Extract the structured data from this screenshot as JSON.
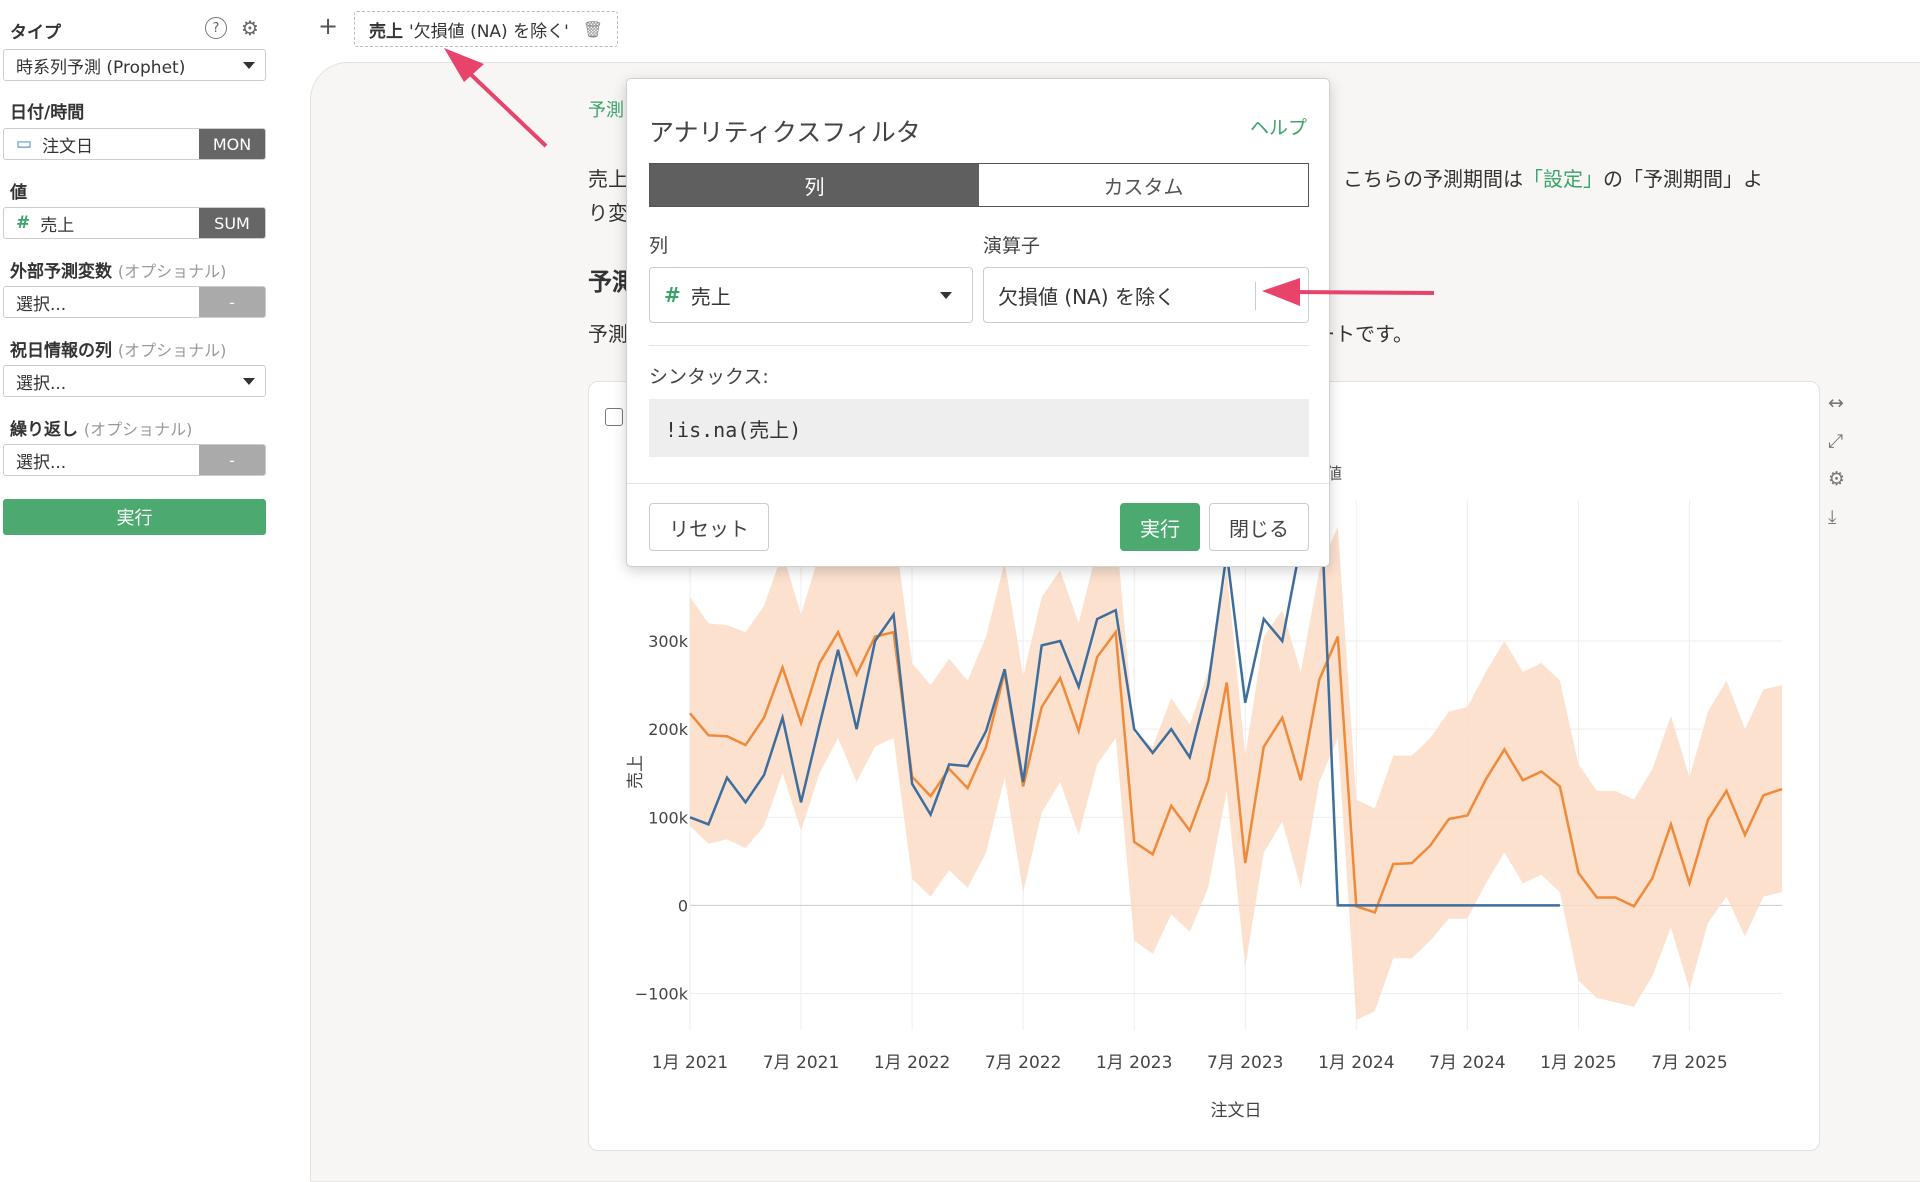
{
  "sidebar": {
    "type_label": "タイプ",
    "type_value": "時系列予測 (Prophet)",
    "date_label": "日付/時間",
    "date_field": "注文日",
    "date_unit": "MON",
    "value_label": "値",
    "value_field": "売上",
    "value_agg": "SUM",
    "ext_label": "外部予測変数",
    "ext_opt": "(オプショナル)",
    "ext_placeholder": "選択...",
    "ext_tag": "-",
    "holiday_label": "祝日情報の列",
    "holiday_opt": "(オプショナル)",
    "holiday_placeholder": "選択...",
    "repeat_label": "繰り返し",
    "repeat_opt": "(オプショナル)",
    "repeat_placeholder": "選択...",
    "repeat_tag": "-",
    "run_label": "実行",
    "help_icon": "?",
    "gear_icon": "⚙"
  },
  "topbar": {
    "add_icon": "+",
    "filter_field": "売上",
    "filter_expr": "'欠損値 (NA) を除く'",
    "trash_icon": "🗑"
  },
  "content": {
    "breadcrumb": "予測",
    "para_left": "売上",
    "para_left2": "り変",
    "para_right_a": "こちらの予測期間は",
    "para_right_link": "「設定」",
    "para_right_b": "の「予測期間」よ",
    "heading": "予測",
    "para2_left": "予測",
    "para2_right": "ートです。"
  },
  "dialog": {
    "title": "アナリティクスフィルタ",
    "help": "ヘルプ",
    "tab_column": "列",
    "tab_custom": "カスタム",
    "column_label": "列",
    "column_value": "売上",
    "operator_label": "演算子",
    "operator_value": "欠損値 (NA) を除く",
    "syntax_label": "シンタックス:",
    "syntax_value": "!is.na(売上)",
    "reset": "リセット",
    "run": "実行",
    "close": "閉じる"
  },
  "chart_data": {
    "type": "line",
    "xlabel": "注文日",
    "ylabel": "売上",
    "legend_partial": "値",
    "ylim": [
      -130000,
      460000
    ],
    "yticks": [
      -100000,
      0,
      100000,
      200000,
      300000
    ],
    "ytick_labels": [
      "−100k",
      "0",
      "100k",
      "200k",
      "300k"
    ],
    "xtick_labels": [
      "1月 2021",
      "7月 2021",
      "1月 2022",
      "7月 2022",
      "1月 2023",
      "7月 2023",
      "1月 2024",
      "7月 2024",
      "1月 2025",
      "7月 2025"
    ],
    "x_start": "2021-01",
    "colors": {
      "actual": "#3e6e9e",
      "forecast": "#ee8a3a",
      "band": "#fbdcc6"
    },
    "actual": [
      100000,
      92000,
      145000,
      117000,
      148000,
      213000,
      117000,
      205000,
      290000,
      200000,
      300000,
      330000,
      138000,
      103000,
      160000,
      158000,
      198000,
      268000,
      140000,
      295000,
      300000,
      248000,
      325000,
      335000,
      200000,
      173000,
      200000,
      168000,
      250000,
      400000,
      230000,
      325000,
      300000,
      410000,
      500000,
      0,
      0,
      0,
      0,
      0,
      0,
      0,
      0,
      0,
      0,
      0,
      0,
      0
    ],
    "forecast": [
      218000,
      193000,
      192000,
      182000,
      213000,
      270000,
      207000,
      275000,
      310000,
      262000,
      305000,
      310000,
      146000,
      124000,
      155000,
      133000,
      180000,
      265000,
      135000,
      225000,
      258000,
      198000,
      282000,
      310000,
      72000,
      58000,
      113000,
      85000,
      142000,
      253000,
      48000,
      180000,
      213000,
      142000,
      256000,
      305000,
      -1000,
      -8000,
      47000,
      48000,
      68000,
      98000,
      102000,
      143000,
      177000,
      142000,
      152000,
      135000,
      37000,
      9000,
      9000,
      -1000,
      31000,
      92000,
      25000,
      97000,
      130000,
      80000,
      125000,
      132000
    ],
    "lower": [
      90000,
      70000,
      75000,
      65000,
      90000,
      150000,
      85000,
      150000,
      190000,
      140000,
      180000,
      190000,
      30000,
      10000,
      40000,
      20000,
      60000,
      145000,
      15000,
      105000,
      140000,
      80000,
      160000,
      190000,
      -40000,
      -55000,
      -10000,
      -30000,
      20000,
      130000,
      -70000,
      60000,
      95000,
      20000,
      140000,
      190000,
      -130000,
      -120000,
      -60000,
      -60000,
      -40000,
      -15000,
      -15000,
      25000,
      60000,
      25000,
      35000,
      15000,
      -85000,
      -105000,
      -110000,
      -115000,
      -80000,
      -25000,
      -95000,
      -20000,
      10000,
      -35000,
      10000,
      15000
    ],
    "upper": [
      350000,
      320000,
      318000,
      310000,
      340000,
      400000,
      330000,
      400000,
      430000,
      385000,
      430000,
      435000,
      275000,
      250000,
      280000,
      255000,
      305000,
      390000,
      260000,
      350000,
      380000,
      320000,
      405000,
      430000,
      195000,
      180000,
      235000,
      205000,
      265000,
      380000,
      170000,
      305000,
      335000,
      265000,
      380000,
      430000,
      120000,
      110000,
      170000,
      170000,
      190000,
      220000,
      225000,
      265000,
      300000,
      265000,
      275000,
      255000,
      160000,
      130000,
      130000,
      120000,
      155000,
      215000,
      145000,
      220000,
      255000,
      200000,
      245000,
      250000
    ]
  }
}
